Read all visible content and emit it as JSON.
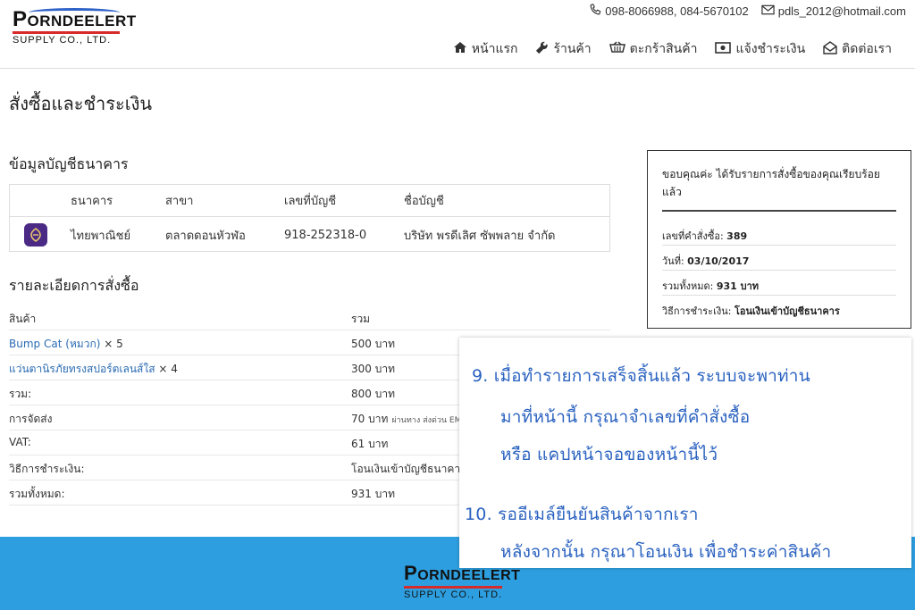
{
  "logo": {
    "top_big": "P",
    "top_rest": "ORNDEELERT",
    "sub": "SUPPLY  CO., LTD."
  },
  "contact": {
    "phones": "098-8066988, 084-5670102",
    "email": "pdls_2012@hotmail.com"
  },
  "nav": [
    {
      "label": "หน้าแรก",
      "icon": "home-icon"
    },
    {
      "label": "ร้านค้า",
      "icon": "wrench-icon"
    },
    {
      "label": "ตะกร้าสินค้า",
      "icon": "cart-icon"
    },
    {
      "label": "แจ้งชำระเงิน",
      "icon": "money-icon"
    },
    {
      "label": "ติดต่อเรา",
      "icon": "envelope-open-icon"
    }
  ],
  "page": {
    "title": "สั่งซื้อและชำระเงิน"
  },
  "bank": {
    "title": "ข้อมูลบัญชีธนาคาร",
    "headers": [
      "ธนาคาร",
      "สาขา",
      "เลขที่บัญชี",
      "ชื่อบัญชี"
    ],
    "row": [
      "ไทยพาณิชย์",
      "ตลาดดอนหัวฬ่อ",
      "918-252318-0",
      "บริษัท พรดีเลิศ ซัพพลาย จำกัด"
    ]
  },
  "order": {
    "title": "รายละเอียดการสั่งซื้อ",
    "rows": [
      {
        "label": "สินค้า",
        "value": "รวม"
      },
      {
        "label": "Bump Cat (หมวก)",
        "qty": " × 5",
        "value": "500 บาท",
        "link": true
      },
      {
        "label": "แว่นตานิรภัยทรงสปอร์ตเลนส์ใส",
        "qty": " × 4",
        "value": "300 บาท",
        "link": true
      },
      {
        "label": "รวม:",
        "value": "800 บาท"
      },
      {
        "label": "การจัดส่ง",
        "value": "70 บาท",
        "note": "ผ่านทาง ส่งด่วน EMS"
      },
      {
        "label": "VAT:",
        "value": "61 บาท"
      },
      {
        "label": "วิธีการชำระเงิน:",
        "value": "โอนเงินเข้าบัญชีธนาคาร"
      },
      {
        "label": "รวมทั้งหมด:",
        "value": "931 บาท"
      }
    ]
  },
  "summary": {
    "thanks": "ขอบคุณค่ะ ได้รับรายการสั่งซื้อของคุณเรียบร้อยแล้ว",
    "rows": [
      {
        "label": "เลขที่คำสั่งซื้อ:",
        "value": "389"
      },
      {
        "label": "วันที่:",
        "value": "03/10/2017"
      },
      {
        "label": "รวมทั้งหมด:",
        "value": "931 บาท"
      },
      {
        "label": "วิธีการชำระเงิน:",
        "value": "โอนเงินเข้าบัญชีธนาคาร"
      }
    ]
  },
  "callout": {
    "lines": [
      "9.  เมื่อทำรายการเสร็จสิ้นแล้ว ระบบจะพาท่าน",
      "มาที่หน้านี้  กรุณาจำเลขที่คำสั่งซื้อ",
      "หรือ  แคปหน้าจอของหน้านี้ไว้",
      "10.  รออีเมล์ยืนยันสินค้าจากเรา",
      "หลังจากนั้น  กรุณาโอนเงิน  เพื่อชำระค่าสินค้า"
    ]
  },
  "colors": {
    "footer": "#2d9fe0",
    "callout_text": "#2a62c0",
    "link": "#2a6bb3",
    "bank": "#4b2a86"
  }
}
